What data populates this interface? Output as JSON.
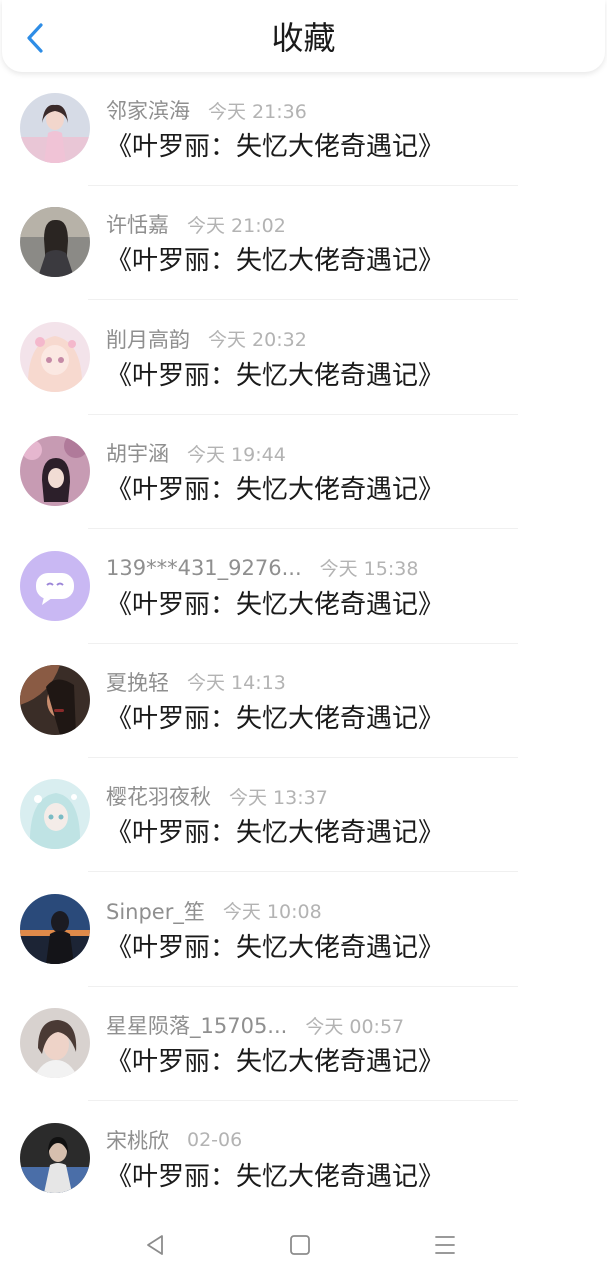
{
  "header": {
    "title": "收藏",
    "back_icon": "chevron-left-icon",
    "accent": "#2e8de6"
  },
  "items": [
    {
      "name": "邻家滨海",
      "time": "今天 21:36",
      "book": "《叶罗丽：失忆大佬奇遇记》"
    },
    {
      "name": "许恬嘉",
      "time": "今天 21:02",
      "book": "《叶罗丽：失忆大佬奇遇记》"
    },
    {
      "name": "削月高韵",
      "time": "今天 20:32",
      "book": "《叶罗丽：失忆大佬奇遇记》"
    },
    {
      "name": "胡宇涵",
      "time": "今天 19:44",
      "book": "《叶罗丽：失忆大佬奇遇记》"
    },
    {
      "name": "139***431_9276...",
      "time": "今天 15:38",
      "book": "《叶罗丽：失忆大佬奇遇记》"
    },
    {
      "name": "夏挽轻",
      "time": "今天 14:13",
      "book": "《叶罗丽：失忆大佬奇遇记》"
    },
    {
      "name": "樱花羽夜秋",
      "time": "今天 13:37",
      "book": "《叶罗丽：失忆大佬奇遇记》"
    },
    {
      "name": "Sinper_笙",
      "time": "今天 10:08",
      "book": "《叶罗丽：失忆大佬奇遇记》"
    },
    {
      "name": "星星陨落_15705...",
      "time": "今天 00:57",
      "book": "《叶罗丽：失忆大佬奇遇记》"
    },
    {
      "name": "宋桃欣",
      "time": "02-06",
      "book": "《叶罗丽：失忆大佬奇遇记》"
    }
  ],
  "navbar": {
    "icons": [
      "back-triangle-icon",
      "home-square-icon",
      "menu-lines-icon"
    ]
  }
}
